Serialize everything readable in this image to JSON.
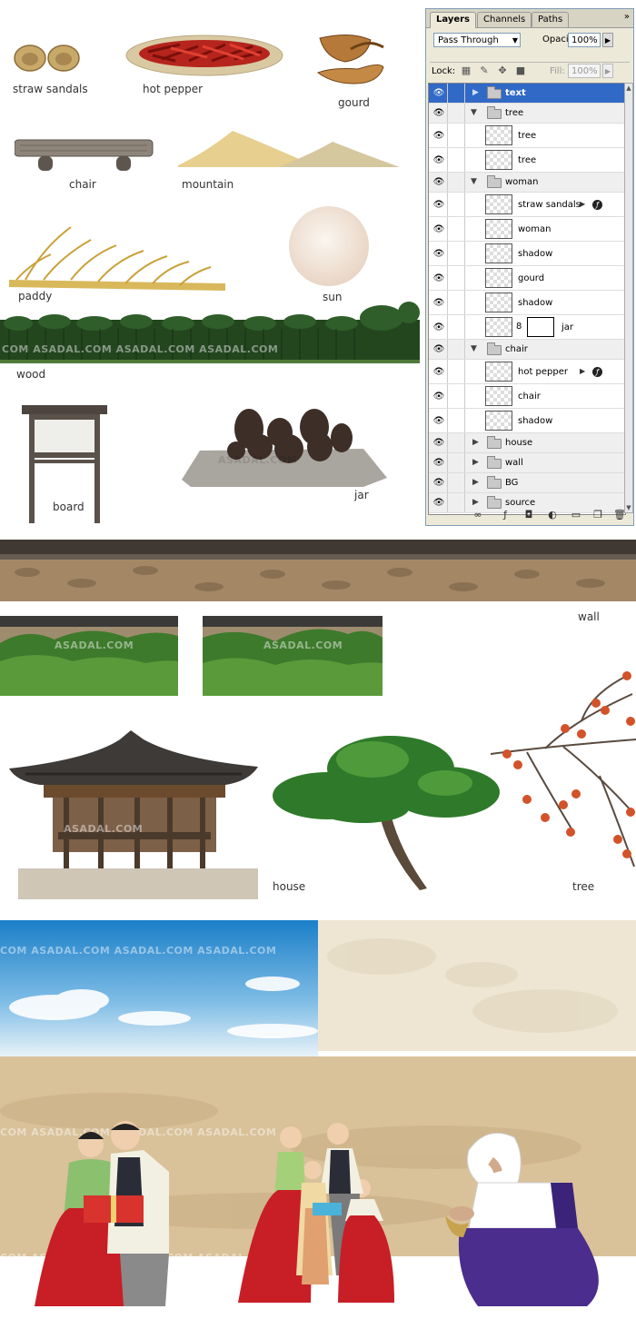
{
  "labels": {
    "straw_sandals": "straw sandals",
    "hot_pepper": "hot pepper",
    "gourd": "gourd",
    "chair": "chair",
    "mountain": "mountain",
    "paddy": "paddy",
    "sun": "sun",
    "wood": "wood",
    "board": "board",
    "jar": "jar",
    "wall": "wall",
    "house": "house",
    "tree": "tree"
  },
  "watermark": "ASADAL.COM",
  "watermark_long": "COM ASADAL.COM ASADAL.COM ASADAL.COM",
  "layers_panel": {
    "tabs": [
      "Layers",
      "Channels",
      "Paths"
    ],
    "menu_icon": "panel-menu-icon",
    "blend_mode": "Pass Through",
    "opacity_label": "Opacity:",
    "opacity_value": "100%",
    "lock_label": "Lock:",
    "fill_label": "Fill:",
    "fill_value": "100%",
    "layers": [
      {
        "name": "text",
        "type": "group",
        "expanded": false,
        "selected": true
      },
      {
        "name": "tree",
        "type": "group",
        "expanded": true
      },
      {
        "name": "tree",
        "type": "layer"
      },
      {
        "name": "tree",
        "type": "layer"
      },
      {
        "name": "woman",
        "type": "group",
        "expanded": true
      },
      {
        "name": "straw sandals",
        "type": "layer",
        "fx": true
      },
      {
        "name": "woman",
        "type": "layer"
      },
      {
        "name": "shadow",
        "type": "layer"
      },
      {
        "name": "gourd",
        "type": "layer"
      },
      {
        "name": "shadow",
        "type": "layer"
      },
      {
        "name": "jar",
        "type": "layer",
        "mask": true
      },
      {
        "name": "chair",
        "type": "group",
        "expanded": true
      },
      {
        "name": "hot pepper",
        "type": "layer",
        "fx": true
      },
      {
        "name": "chair",
        "type": "layer"
      },
      {
        "name": "shadow",
        "type": "layer"
      },
      {
        "name": "house",
        "type": "group",
        "expanded": false
      },
      {
        "name": "wall",
        "type": "group",
        "expanded": false
      },
      {
        "name": "BG",
        "type": "group",
        "expanded": false
      },
      {
        "name": "source",
        "type": "group",
        "expanded": false
      }
    ],
    "bottom_icons": [
      "link-layers-icon",
      "layer-style-icon",
      "add-mask-icon",
      "new-group-icon",
      "adjustment-layer-icon",
      "new-layer-icon",
      "delete-layer-icon"
    ]
  }
}
